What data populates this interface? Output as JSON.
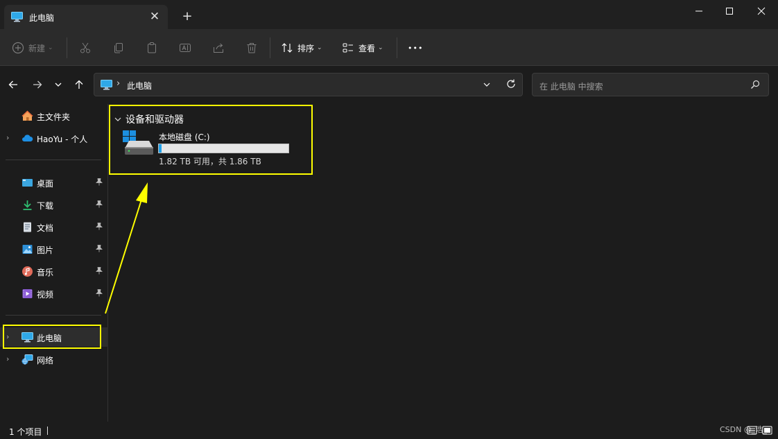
{
  "window": {
    "tab_title": "此电脑",
    "tab_close": "✕",
    "new_tab": "+",
    "minimize_label": "最小化",
    "maximize_label": "最大化",
    "close_label": "关闭"
  },
  "toolbar": {
    "new_label": "新建",
    "sort_label": "排序",
    "view_label": "查看",
    "more_label": "•••"
  },
  "address": {
    "path_item": "此电脑",
    "separator": "›"
  },
  "search": {
    "placeholder": "在 此电脑 中搜索"
  },
  "sidebar": {
    "top": [
      {
        "label": "主文件夹",
        "icon": "home-icon"
      },
      {
        "label": "HaoYu - 个人",
        "icon": "onedrive-cloud-icon"
      }
    ],
    "pinned": [
      {
        "label": "桌面",
        "icon": "desktop-icon"
      },
      {
        "label": "下载",
        "icon": "download-icon"
      },
      {
        "label": "文档",
        "icon": "document-icon"
      },
      {
        "label": "图片",
        "icon": "pictures-icon"
      },
      {
        "label": "音乐",
        "icon": "music-icon"
      },
      {
        "label": "视频",
        "icon": "video-icon"
      }
    ],
    "bottom": [
      {
        "label": "此电脑",
        "icon": "this-pc-icon",
        "selected": true
      },
      {
        "label": "网络",
        "icon": "network-icon"
      }
    ]
  },
  "main": {
    "group_title": "设备和驱动器",
    "drives": [
      {
        "name": "本地磁盘 (C:)",
        "info": "1.82 TB 可用，共 1.86 TB",
        "used_fraction": 0.0215
      }
    ]
  },
  "status": {
    "item_count": "1 个项目",
    "watermark": "CSDN @_浩_"
  },
  "colors": {
    "accent": "#1ea0ea",
    "highlight": "#ffff00",
    "background": "#1c1c1c"
  }
}
